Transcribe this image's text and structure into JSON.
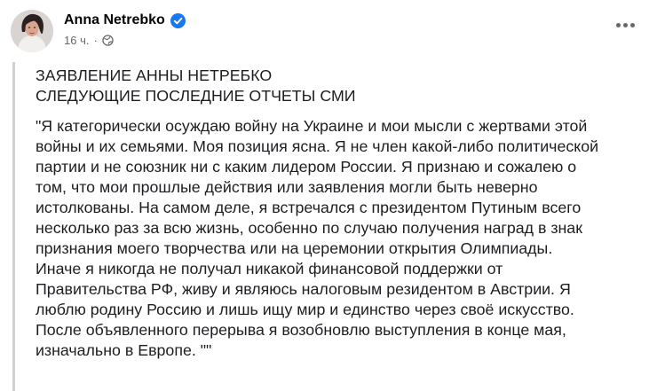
{
  "post": {
    "author": "Anna Netrebko",
    "time": "16 ч.",
    "separator": "·",
    "heading_lines": [
      "ЗАЯВЛЕНИЕ АННЫ НЕТРЕБКО",
      "СЛЕДУЮЩИЕ ПОСЛЕДНИЕ ОТЧЕТЫ СМИ"
    ],
    "body_lines": [
      "\"Я категорически осуждаю войну на Украине и мои мысли с жертвами этой",
      "войны и их семьями. Моя позиция ясна. Я не член какой-либо политической",
      "партии и не союзник ни с каким лидером России. Я признаю и сожалею о",
      "том, что мои прошлые действия или заявления могли быть неверно",
      "истолкованы. На самом деле, я встречался с президентом Путиным всего",
      "несколько раз за всю жизнь, особенно по случаю получения наград в знак",
      "признания моего творчества или на церемонии открытия Олимпиады.",
      "Иначе я никогда не получал никакой финансовой поддержки от",
      "Правительства РФ, живу и являюсь налоговым резидентом в Австрии. Я",
      "люблю родину Россию и лишь ищу мир и единство через своё искусство.",
      "После объявленного перерыва я возобновлю выступления в конце мая,",
      "изначально в Европе. \"\""
    ]
  },
  "icons": {
    "verified": "verified-badge-icon",
    "audience": "globe-icon",
    "more": "more-options-icon"
  },
  "colors": {
    "verified_blue": "#1877f2",
    "meta_gray": "#65676b",
    "quote_bar": "#ced0d4"
  }
}
